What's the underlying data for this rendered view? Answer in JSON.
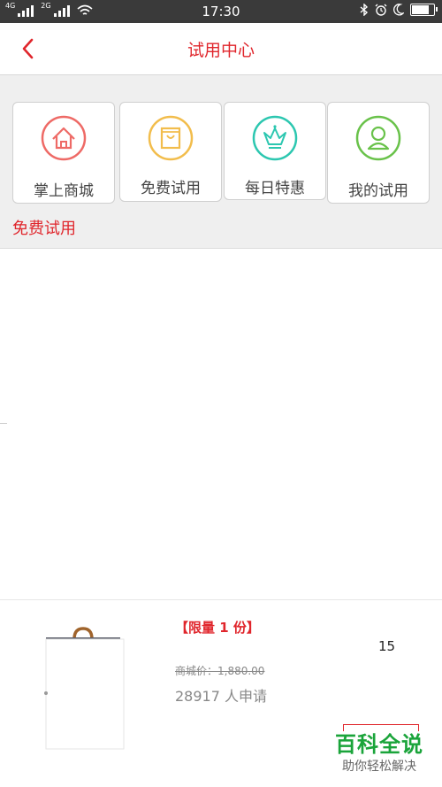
{
  "status_bar": {
    "left_networks": [
      "4G",
      "2G"
    ],
    "time": "17:30"
  },
  "navbar": {
    "title": "试用中心",
    "back_icon": "chevron-left-icon"
  },
  "categories": [
    {
      "label": "掌上商城",
      "icon": "house-icon",
      "color": "#ee6a66"
    },
    {
      "label": "免费试用",
      "icon": "shopping-bag-icon",
      "color": "#f2bd4c"
    },
    {
      "label": "每日特惠",
      "icon": "crown-icon",
      "color": "#2cc7b0"
    },
    {
      "label": "我的试用",
      "icon": "user-icon",
      "color": "#69c24a"
    }
  ],
  "section_label": "免费试用",
  "product": {
    "limit_tag": "【限量 1 份】",
    "market_price": "商城价：1,880.00",
    "applicants": "28917 人申请",
    "count": "15"
  },
  "watermark": {
    "title": "百科全说",
    "subtitle": "助你轻松解决"
  },
  "colors": {
    "accent": "#e0262c",
    "status_bar": "#3a3a3a",
    "background": "#efefef"
  }
}
